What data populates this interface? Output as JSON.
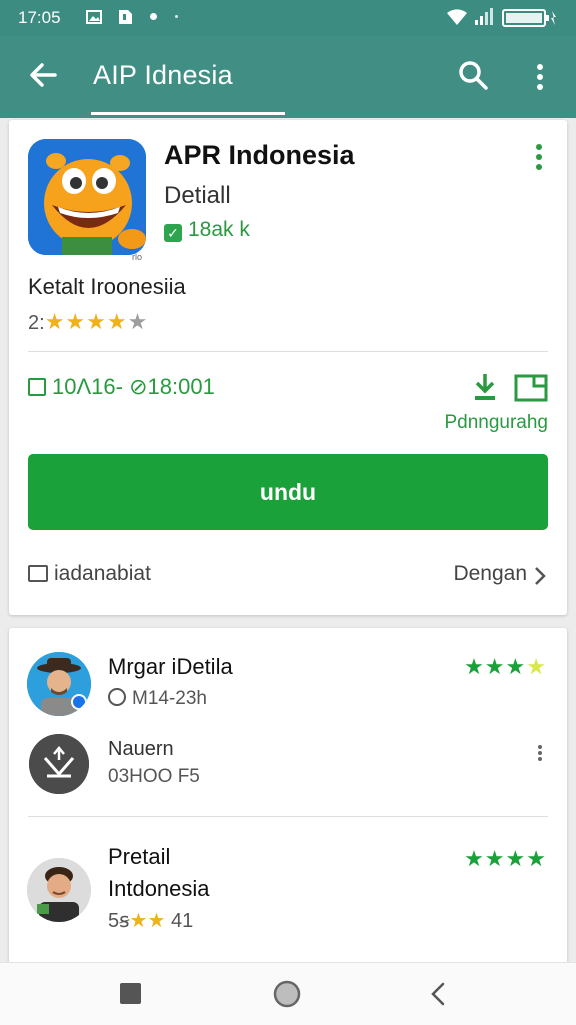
{
  "status_bar": {
    "time": "17:05",
    "icons": [
      "gallery-icon",
      "sim-icon",
      "notification-dot-icon",
      "wifi-icon",
      "signal-icon",
      "battery-icon"
    ]
  },
  "app_bar": {
    "title": "AIP Idnesia",
    "icons": [
      "back-arrow-icon",
      "search-icon",
      "more-vert-icon"
    ]
  },
  "app_card": {
    "name": "APR Indonesia",
    "subtitle": "Detiall",
    "verified_text": "18ak k",
    "icon_caption": "rlo",
    "developer": "Ketalt Iroonesiia",
    "rating_prefix": "2:",
    "stars": {
      "filled": 4,
      "total": 5
    },
    "meta": "10Λ16- ⊘18:001",
    "action_label": "Pdnngurahg",
    "install_label": "undu",
    "footer_left": "iadanabiat",
    "footer_right": "Dengan",
    "accent_color": "#1aa13a"
  },
  "reviews": [
    {
      "name": "Mrgar iDetila",
      "meta": "M14-23h",
      "stars": 4
    },
    {
      "name": "Nauern",
      "meta": "03ΗΟΟ F5"
    },
    {
      "name": "Pretail",
      "name2": "Intdonesia",
      "meta_prefix": "5ꞩ",
      "meta_suffix": "41",
      "stars": 4
    }
  ],
  "nav_bar": {
    "icons": [
      "recents-square-icon",
      "home-circle-icon",
      "back-chevron-icon"
    ]
  }
}
